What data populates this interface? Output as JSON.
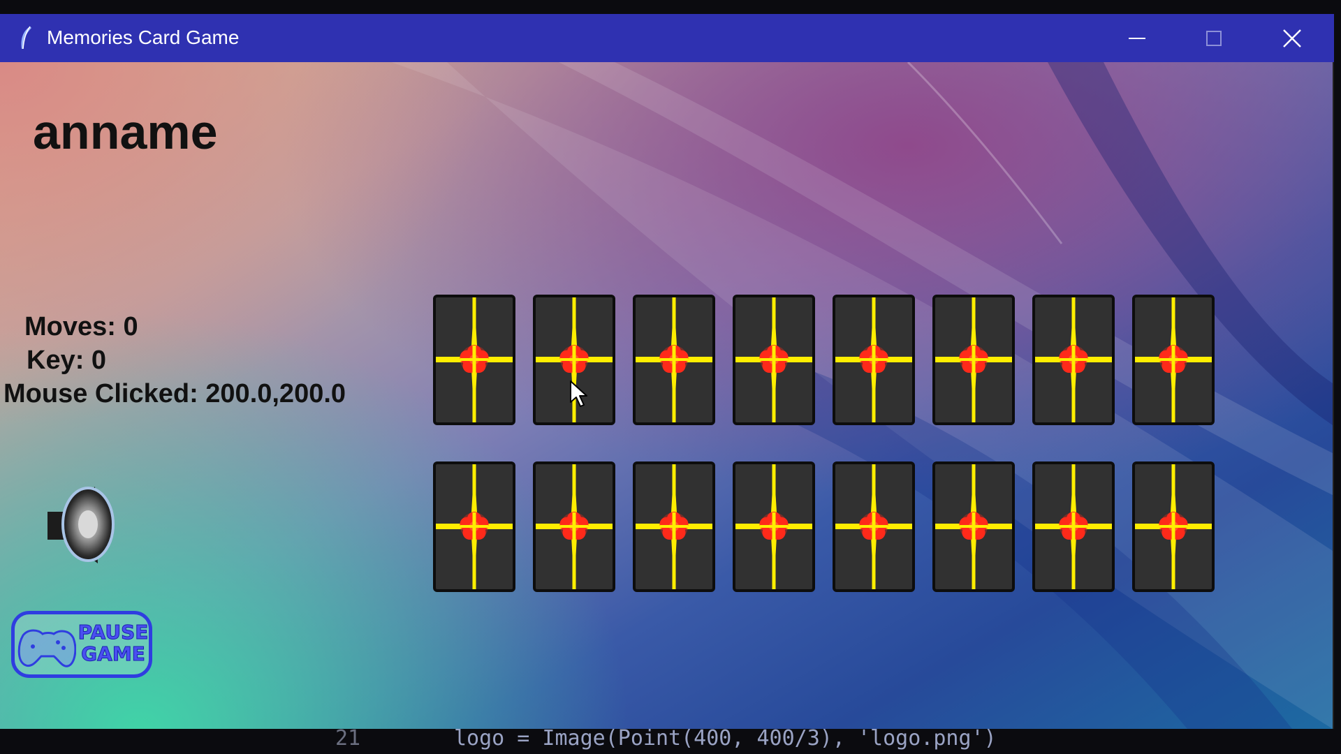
{
  "window": {
    "title": "Memories Card Game",
    "icon": "feather-icon",
    "titlebar_color": "#2f31b1"
  },
  "game": {
    "player_name": "anname",
    "moves_label": "Moves: 0",
    "key_label": "Key: 0",
    "mouse_label": "Mouse Clicked: 200.0,200.0",
    "pause_button": {
      "line1": "PAUSE",
      "line2": "GAME"
    },
    "sound_icon": "speaker-icon",
    "cards": {
      "rows": 2,
      "columns": 8,
      "state": "face-down",
      "back_design": "yellow-cross-red-flower",
      "colors": {
        "card": "#313131",
        "stripe": "#ffee00",
        "flower": "#ff2a1a"
      }
    }
  },
  "background_code": {
    "line_number": "21",
    "text": "logo = Image(Point(400, 400/3), 'logo.png')"
  }
}
